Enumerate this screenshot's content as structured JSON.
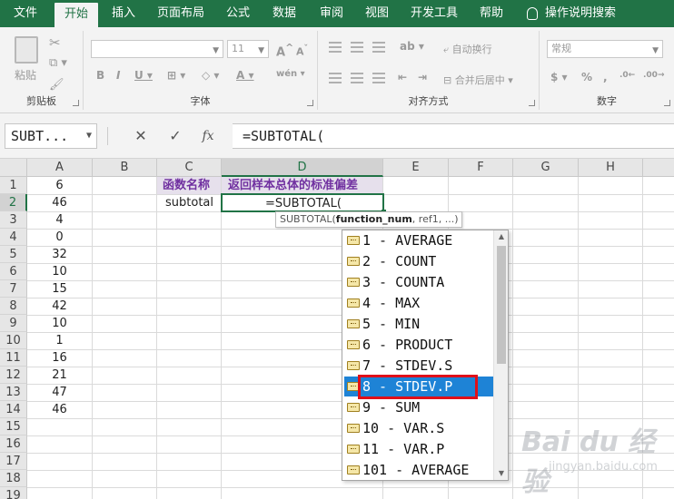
{
  "ribbon_tabs": [
    "文件",
    "开始",
    "插入",
    "页面布局",
    "公式",
    "数据",
    "审阅",
    "视图",
    "开发工具",
    "帮助"
  ],
  "active_tab": "开始",
  "tell_me": "操作说明搜索",
  "groups": {
    "clipboard": {
      "name": "剪贴板",
      "paste": "粘贴"
    },
    "font": {
      "name": "字体",
      "size": "11"
    },
    "alignment": {
      "name": "对齐方式",
      "wrap": "自动换行",
      "merge": "合并后居中"
    },
    "number": {
      "name": "数字",
      "format": "常规"
    }
  },
  "formula_bar": {
    "name_box": "SUBT...",
    "cancel": "✕",
    "enter": "✓",
    "fx": "fx",
    "formula": "=SUBTOTAL("
  },
  "columns": [
    "A",
    "B",
    "C",
    "D",
    "E",
    "F",
    "G",
    "H"
  ],
  "rows": [
    "1",
    "2",
    "3",
    "4",
    "5",
    "6",
    "7",
    "8",
    "9",
    "10",
    "11",
    "12",
    "13",
    "14",
    "15",
    "16",
    "17",
    "18",
    "19"
  ],
  "column_a": [
    "6",
    "46",
    "4",
    "0",
    "32",
    "10",
    "15",
    "42",
    "10",
    "1",
    "16",
    "21",
    "47",
    "46"
  ],
  "c1": "函数名称",
  "d1": "返回样本总体的标准偏差",
  "c2": "subtotal",
  "d2": "=SUBTOTAL(",
  "tooltip": {
    "func": "SUBTOTAL(",
    "arg": "function_num",
    "rest": ", ref1, ...)"
  },
  "autocomplete": [
    "1 - AVERAGE",
    "2 - COUNT",
    "3 - COUNTA",
    "4 - MAX",
    "5 - MIN",
    "6 - PRODUCT",
    "7 - STDEV.S",
    "8 - STDEV.P",
    "9 - SUM",
    "10 - VAR.S",
    "11 - VAR.P",
    "101 - AVERAGE"
  ],
  "selected_option": "8 - STDEV.P",
  "watermark": {
    "logo": "Bai du 经验",
    "url": "jingyan.baidu.com"
  },
  "colors": {
    "excel_green": "#217346",
    "highlight": "#1e83d6",
    "red_box": "#e0101a",
    "header_purple": "#7030a0"
  }
}
